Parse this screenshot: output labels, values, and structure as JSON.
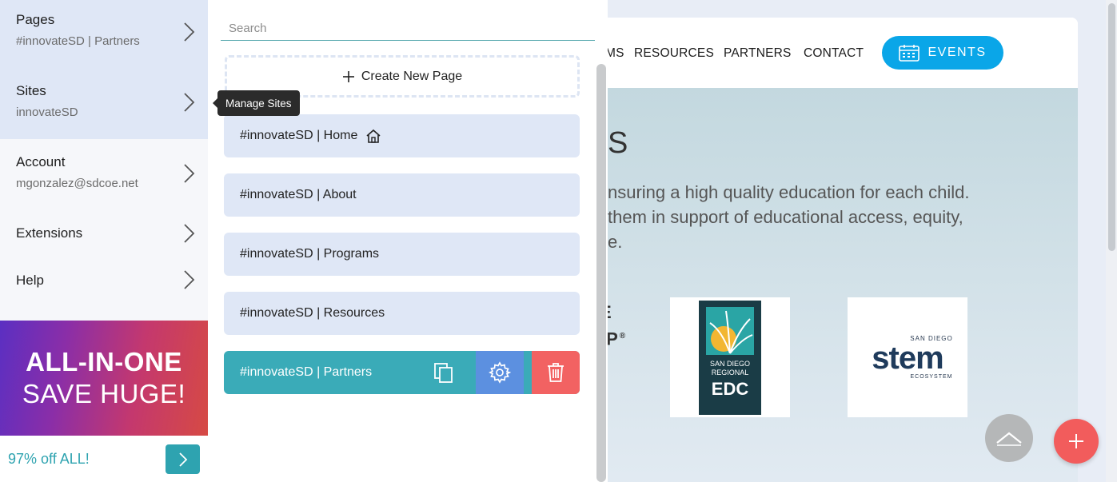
{
  "site": {
    "nav": {
      "partial_link": "MS",
      "resources": "RESOURCES",
      "partners": "PARTNERS",
      "contact": "CONTACT",
      "events": "EVENTS"
    },
    "hero": {
      "heading_partial": "S",
      "text_partial": "nsuring a high quality education for each child.\nthem in support of educational access, equity,\ne."
    },
    "logos": {
      "partial_logo_line1": "E",
      "partial_logo_line2": "IP",
      "partial_logo_reg": "®",
      "edc_small": "SAN DIEGO\nREGIONAL",
      "edc_big": "EDC",
      "stem_small": "SAN DIEGO",
      "stem_word": "stem",
      "stem_eco": "ECOSYSTEM"
    }
  },
  "leftnav": {
    "items": [
      {
        "title": "Pages",
        "subtitle": "#innovateSD | Partners"
      },
      {
        "title": "Sites",
        "subtitle": "innovateSD"
      },
      {
        "title": "Account",
        "subtitle": "mgonzalez@sdcoe.net"
      },
      {
        "title": "Extensions"
      },
      {
        "title": "Help"
      }
    ],
    "promo": {
      "line1": "ALL-IN-ONE",
      "line2": "SAVE HUGE!",
      "offer": "97% off ALL!"
    }
  },
  "tooltip": "Manage Sites",
  "pages_panel": {
    "search_placeholder": "Search",
    "create_label": "Create New Page",
    "pages": [
      "#innovateSD | Home",
      "#innovateSD | About",
      "#innovateSD | Programs",
      "#innovateSD | Resources",
      "#innovateSD | Partners"
    ]
  },
  "colors": {
    "accent_teal": "#3aabb8",
    "gear_blue": "#5c90e0",
    "delete_red": "#f26262",
    "events_blue": "#0aa6e8",
    "active_row": "#dfe7f6"
  }
}
